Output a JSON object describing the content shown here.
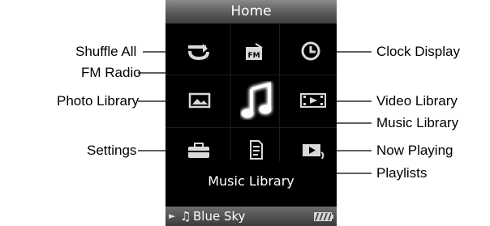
{
  "screen": {
    "title": "Home",
    "selected_label": "Music Library",
    "now_playing": {
      "play_glyph": "►",
      "note_glyph": "♫",
      "song": "Blue Sky"
    }
  },
  "callouts": {
    "left": [
      "Shuffle All",
      "FM Radio",
      "Photo Library",
      "Settings"
    ],
    "right": [
      "Clock Display",
      "Video Library",
      "Music Library",
      "Now Playing",
      "Playlists"
    ]
  },
  "icons": [
    "shuffle-all-icon",
    "fm-radio-icon",
    "clock-display-icon",
    "photo-library-icon",
    "music-library-icon",
    "video-library-icon",
    "settings-icon",
    "playlists-icon",
    "now-playing-icon"
  ],
  "colors": {
    "screen_bg": "#000000",
    "title_bar": "#5a5a5a",
    "icon": "#d9d9d9",
    "selected_glow": "#ffffff"
  }
}
